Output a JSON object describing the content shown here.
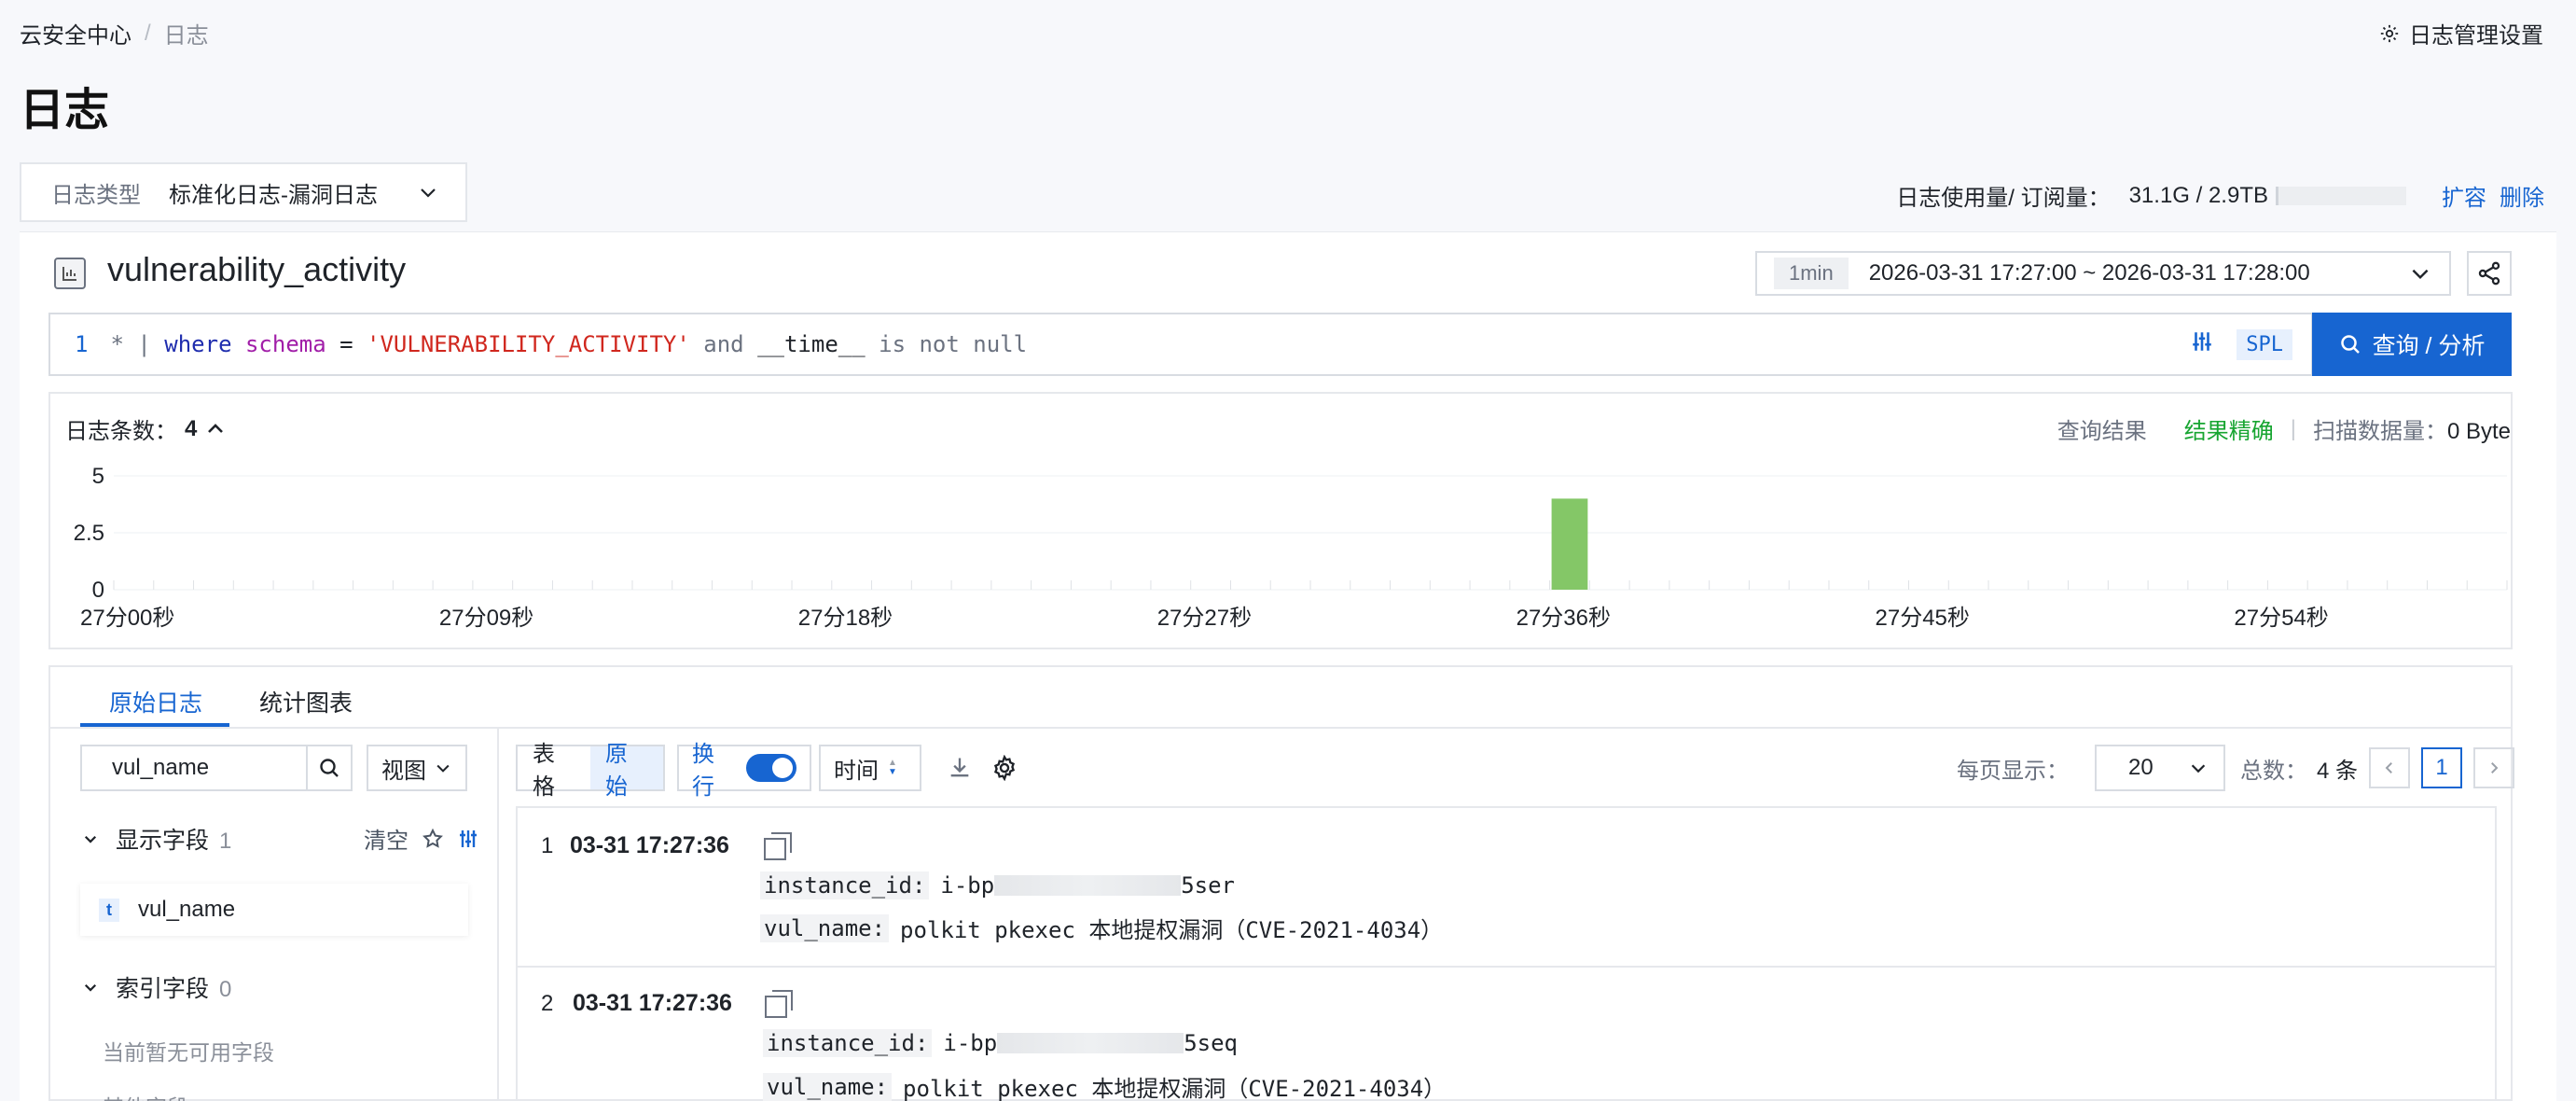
{
  "breadcrumb": {
    "root": "云安全中心",
    "separator": "/",
    "current": "日志"
  },
  "header": {
    "settings_label": "日志管理设置",
    "title": "日志"
  },
  "log_type": {
    "label": "日志类型",
    "value": "标准化日志-漏洞日志"
  },
  "usage": {
    "label": "日志使用量/ 订阅量：",
    "value": "31.1G / 2.9TB",
    "expand": "扩容",
    "delete": "删除"
  },
  "logstore": {
    "name": "vulnerability_activity"
  },
  "time": {
    "granularity": "1min",
    "range": "2026-03-31 17:27:00 ~ 2026-03-31 17:28:00"
  },
  "query": {
    "line_no": "1",
    "tokens": {
      "star": "* |",
      "where": "where",
      "field": "schema",
      "eq": "=",
      "str": "'VULNERABILITY_ACTIVITY'",
      "and": "and",
      "time": "__time__",
      "isnot": "is not null"
    },
    "spl": "SPL",
    "search_button": "查询 / 分析"
  },
  "histogram": {
    "count_label": "日志条数：",
    "count_value": "4",
    "result_label": "查询结果",
    "result_status": "结果精确",
    "scan_label": "扫描数据量：",
    "scan_value": "0 Byte"
  },
  "chart_data": {
    "type": "bar",
    "yticks": [
      "5",
      "2.5",
      "0"
    ],
    "ylim": [
      0,
      5
    ],
    "xticks": [
      "27分00秒",
      "27分09秒",
      "27分18秒",
      "27分27秒",
      "27分36秒",
      "27分45秒",
      "27分54秒"
    ],
    "bar_color": "#84c767",
    "x": [
      36
    ],
    "values": [
      4
    ]
  },
  "tabs": [
    {
      "label": "原始日志",
      "active": true
    },
    {
      "label": "统计图表",
      "active": false
    }
  ],
  "sidebar": {
    "search_value": "vul_name",
    "view_label": "视图",
    "shown_fields_label": "显示字段",
    "shown_fields_count": "1",
    "clear_label": "清空",
    "shown_fields": [
      {
        "type": "t",
        "name": "vul_name"
      }
    ],
    "index_fields_label": "索引字段",
    "index_fields_count": "0",
    "empty_note": "当前暂无可用字段",
    "cut_label": "其他字段"
  },
  "toolbar": {
    "table": "表格",
    "raw": "原始",
    "wrap": "换行",
    "time": "时间",
    "per_page_label": "每页显示：",
    "per_page": "20",
    "total_label": "总数：",
    "total": "4 条",
    "current_page": "1"
  },
  "records": [
    {
      "index": "1",
      "time": "03-31 17:27:36",
      "instance_key": "instance_id:",
      "instance_prefix": "i-bp",
      "instance_suffix": "5ser",
      "vul_key": "vul_name:",
      "vul_value": "polkit pkexec 本地提权漏洞（CVE-2021-4034）"
    },
    {
      "index": "2",
      "time": "03-31 17:27:36",
      "instance_key": "instance_id:",
      "instance_prefix": "i-bp",
      "instance_suffix": "5seq",
      "vul_key": "vul_name:",
      "vul_value": "polkit pkexec 本地提权漏洞（CVE-2021-4034）"
    }
  ]
}
